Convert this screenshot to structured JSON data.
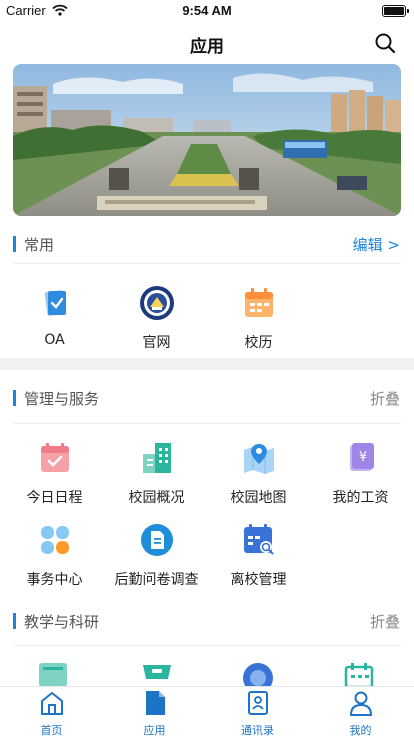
{
  "status": {
    "carrier": "Carrier",
    "time": "9:54 AM"
  },
  "header": {
    "title": "应用"
  },
  "common": {
    "title": "常用",
    "action": "编辑 >",
    "items": [
      {
        "label": "OA"
      },
      {
        "label": "官网"
      },
      {
        "label": "校历"
      }
    ]
  },
  "services": {
    "title": "管理与服务",
    "action": "折叠",
    "items": [
      {
        "label": "今日日程"
      },
      {
        "label": "校园概况"
      },
      {
        "label": "校园地图"
      },
      {
        "label": "我的工资"
      },
      {
        "label": "事务中心"
      },
      {
        "label": "后勤问卷调查"
      },
      {
        "label": "离校管理"
      }
    ]
  },
  "teaching": {
    "title": "教学与科研",
    "action": "折叠"
  },
  "tabbar": [
    {
      "label": "首页"
    },
    {
      "label": "应用"
    },
    {
      "label": "通讯录"
    },
    {
      "label": "我的"
    }
  ],
  "colors": {
    "accent": "#1d86d8",
    "tab": "#1d73c4"
  }
}
